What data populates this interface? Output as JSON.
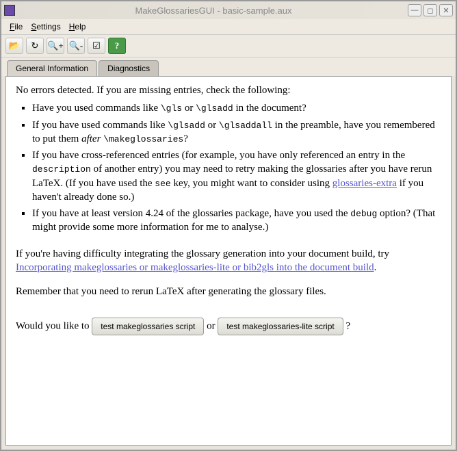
{
  "title": "MakeGlossariesGUI - basic-sample.aux",
  "menu": {
    "file": "File",
    "settings": "Settings",
    "help": "Help"
  },
  "tabs": {
    "general": "General Information",
    "diagnostics": "Diagnostics"
  },
  "intro": "No errors detected. If you are missing entries, check the following:",
  "bullets": {
    "b1_a": "Have you used commands like ",
    "b1_code1": "\\gls",
    "b1_b": " or ",
    "b1_code2": "\\glsadd",
    "b1_c": " in the document?",
    "b2_a": "If you have used commands like ",
    "b2_code1": "\\glsadd",
    "b2_b": " or ",
    "b2_code2": "\\glsaddall",
    "b2_c": " in the preamble, have you remembered to put them ",
    "b2_after": "after",
    "b2_d": " ",
    "b2_code3": "\\makeglossaries",
    "b2_e": "?",
    "b3_a": "If you have cross-referenced entries (for example, you have only referenced an entry in the ",
    "b3_code1": "description",
    "b3_b": " of another entry) you may need to retry making the glossaries after you have rerun LaTeX. (If you have used the ",
    "b3_code2": "see",
    "b3_c": " key, you might want to consider using ",
    "b3_link": "glossaries-extra",
    "b3_d": " if you haven't already done so.)",
    "b4_a": "If you have at least version 4.24 of the glossaries package, have you used the ",
    "b4_code1": "debug",
    "b4_b": " option? (That might provide some more information for me to analyse.)"
  },
  "para2_a": "If you're having difficulty integrating the glossary generation into your document build, try ",
  "para2_link": "Incorporating makeglossaries or makeglossaries-lite or bib2gls into the document build",
  "para2_b": ".",
  "para3": "Remember that you need to rerun LaTeX after generating the glossary files.",
  "bottom_a": "Would you like to ",
  "btn1": "test makeglossaries script",
  "bottom_b": " or ",
  "btn2": "test makeglossaries-lite script",
  "bottom_c": "?"
}
